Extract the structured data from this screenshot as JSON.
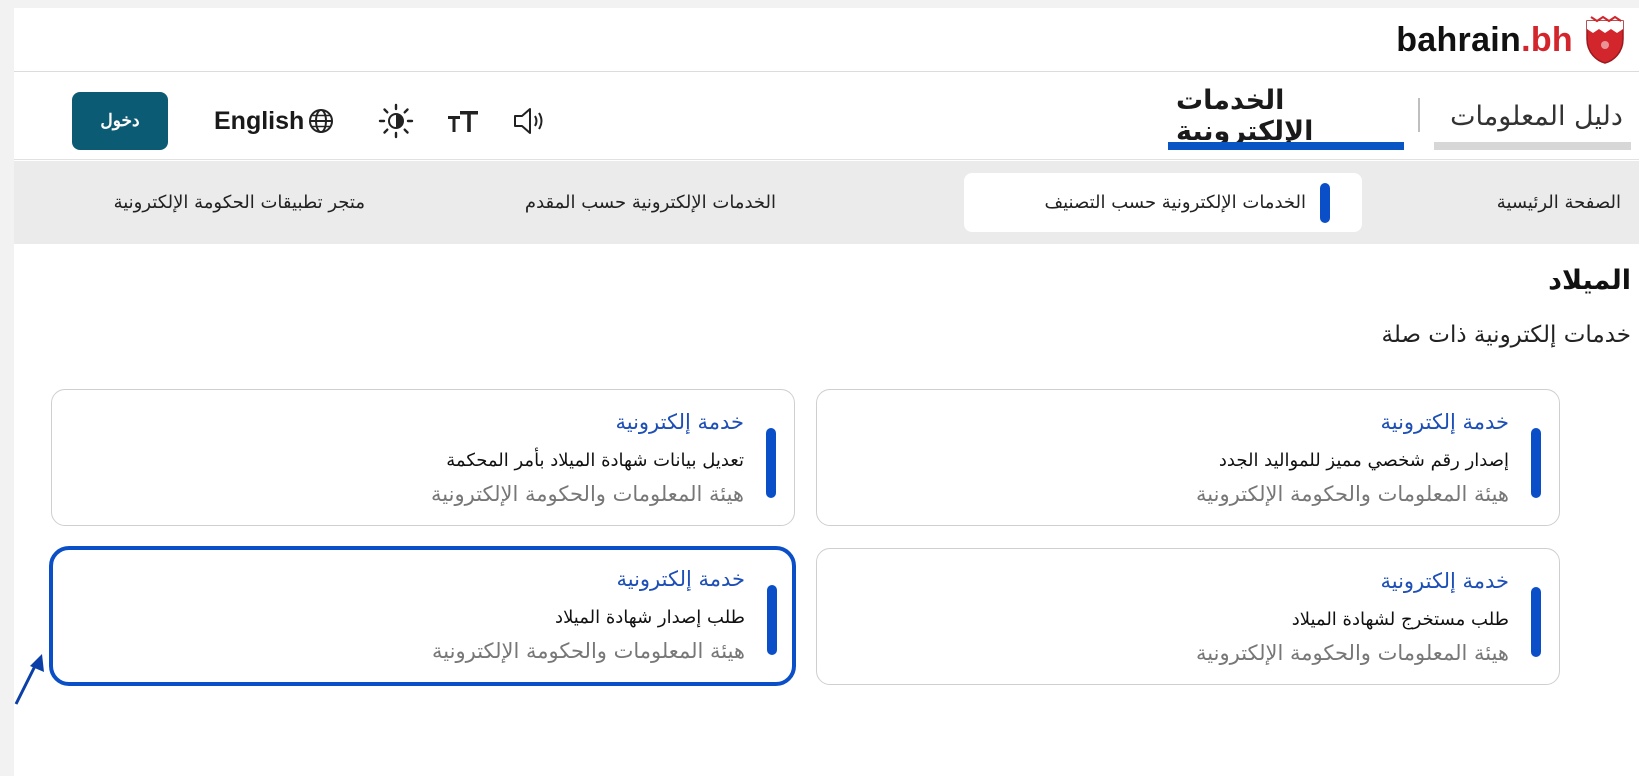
{
  "header": {
    "logo_name": "bahrain",
    "logo_tld": ".bh",
    "crest_colors": {
      "red": "#d2262c",
      "white": "#ffffff"
    }
  },
  "nav": {
    "info_label": "دليل المعلومات",
    "services_label": "الخدمات الإلكترونية",
    "language_label": "English",
    "login_label": "دخول"
  },
  "subnav": {
    "home": "الصفحة الرئيسية",
    "by_category": "الخدمات الإلكترونية حسب التصنيف",
    "by_provider": "الخدمات الإلكترونية حسب المقدم",
    "app_store": "متجر تطبيقات الحكومة الإلكترونية"
  },
  "page": {
    "heading": "الميلاد",
    "subheading": "خدمات إلكترونية ذات صلة"
  },
  "cards": [
    {
      "type": "خدمة إلكترونية",
      "title": "إصدار رقم شخصي مميز للمواليد الجدد",
      "entity": "هيئة المعلومات والحكومة الإلكترونية"
    },
    {
      "type": "خدمة إلكترونية",
      "title": "تعديل بيانات شهادة الميلاد بأمر المحكمة",
      "entity": "هيئة المعلومات والحكومة الإلكترونية"
    },
    {
      "type": "خدمة إلكترونية",
      "title": "طلب مستخرج لشهادة الميلاد",
      "entity": "هيئة المعلومات والحكومة الإلكترونية"
    },
    {
      "type": "خدمة إلكترونية",
      "title": "طلب إصدار شهادة الميلاد",
      "entity": "هيئة المعلومات والحكومة الإلكترونية"
    }
  ],
  "colors": {
    "accent_blue": "#0a4fc8",
    "login_bg": "#0c5b74",
    "service_link": "#1d4fb7"
  },
  "icons": [
    "crest-icon",
    "globe-icon",
    "brightness-icon",
    "text-size-icon",
    "speaker-icon",
    "annotation-arrow-icon"
  ]
}
